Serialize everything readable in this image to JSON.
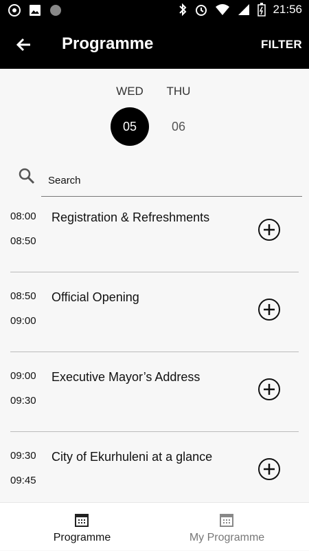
{
  "status_bar": {
    "time": "21:56"
  },
  "app_bar": {
    "title": "Programme",
    "filter_label": "FILTER"
  },
  "days": [
    {
      "weekday": "WED",
      "date": "05",
      "selected": true
    },
    {
      "weekday": "THU",
      "date": "06",
      "selected": false
    }
  ],
  "search": {
    "placeholder": "Search"
  },
  "sessions": [
    {
      "start": "08:00",
      "end": "08:50",
      "title": "Registration & Refreshments"
    },
    {
      "start": "08:50",
      "end": "09:00",
      "title": "Official Opening"
    },
    {
      "start": "09:00",
      "end": "09:30",
      "title": "Executive Mayor’s Address"
    },
    {
      "start": "09:30",
      "end": "09:45",
      "title": "City of Ekurhuleni at a glance"
    }
  ],
  "bottom_nav": [
    {
      "label": "Programme",
      "icon": "calendar-icon",
      "active": true
    },
    {
      "label": "My Programme",
      "icon": "calendar-icon",
      "active": false
    }
  ],
  "colors": {
    "app_bar": "#000000",
    "background": "#f7f7f7",
    "active_text": "#111111",
    "inactive_text": "#777777"
  }
}
